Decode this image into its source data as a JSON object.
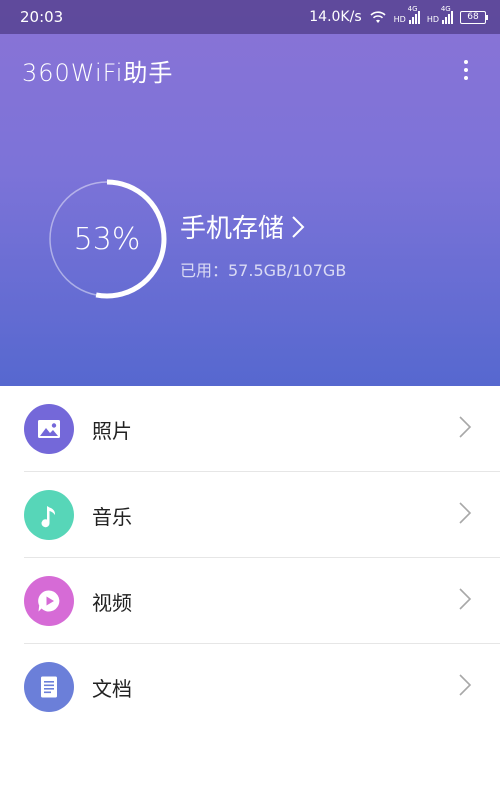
{
  "status_bar": {
    "time": "20:03",
    "speed": "14.0K/s",
    "hd_label": "HD",
    "network_label": "4G",
    "battery": "68"
  },
  "app_bar": {
    "title": "360WiFi助手"
  },
  "storage": {
    "percent_text": "53%",
    "percent_value": 53,
    "title": "手机存储",
    "used_label": "已用：57.5GB/107GB"
  },
  "categories": [
    {
      "label": "照片",
      "icon": "image-icon",
      "color": "#7468d9"
    },
    {
      "label": "音乐",
      "icon": "music-note-icon",
      "color": "#57d6b8"
    },
    {
      "label": "视频",
      "icon": "video-play-icon",
      "color": "#d66bd6"
    },
    {
      "label": "文档",
      "icon": "document-icon",
      "color": "#6b7fd9"
    }
  ]
}
